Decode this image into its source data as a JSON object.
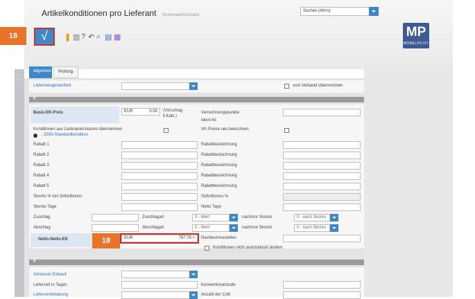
{
  "header": {
    "title": "Artikelkonditionen pro Lieferant",
    "subtitle": "Systemadministrator",
    "search_value": "Suchen (Alt+s)",
    "logo_text": "MP",
    "logo_subtext": "MÖBELPILOT"
  },
  "toolbar": {
    "save_symbol": "√",
    "icons": [
      "bookmark-icon",
      "trash-icon",
      "help-icon",
      "back-icon",
      "search-icon",
      "print-icon",
      "calendar-icon"
    ]
  },
  "badges": {
    "top": "18",
    "mid": "18"
  },
  "tabs": [
    "allgemein",
    "Prüfung"
  ],
  "form": {
    "liefermengeneinheit": "Liefermengeneinheit",
    "vom_verband": "vom Verband übernommen",
    "basis_ek_label": "Basis-EK-Preis",
    "basis_ek_currency": "EUR",
    "basis_ek_value": "0.00",
    "vorschlag": "(Vorschlag lt.Kalk.)",
    "verrechnungspunkte": "Verrechnungspunkte",
    "ident_nr": "Ident-Nr.",
    "konditionen_aus": "Konditionen aus Lieferantenstamm übernehmen",
    "emv_standard": "→EMV-Standardkondition",
    "vk_preise": "VK-Preise neu berechnen",
    "rabatt1": "Rabatt 1",
    "rabatt2": "Rabatt 2",
    "rabatt3": "Rabatt 3",
    "rabatt4": "Rabatt 4",
    "rabatt5": "Rabatt 5",
    "rabattbezeichnung": "Rabattbezeichnung",
    "skonto_sofortbonus": "Skonto % incl.Sofortbonus",
    "sofortbonus": "Sofortbonus %",
    "skonto_tage": "Skonto Tage",
    "netto_tage": "Netto Tage",
    "zuschlag": "Zuschlag",
    "zuschlagart": "Zuschlagart",
    "zuschlagart_value": "0 - Wert",
    "nach_vor_skonto": "nach/vor Skonto",
    "nach_skonto_value": "0 - nach Skonto",
    "abschlag": "Abschlag",
    "abschlagart": "Abschlagart",
    "abschlagart_value": "0 - Wert",
    "nach_vor_skonto2": "nach/vor Skonto",
    "nach_skonto_value2": "0 - nach Skonto",
    "netto_netto_label": "Netto-Netto-EK",
    "netto_currency": "EUR",
    "netto_value": "797.78 ×",
    "nachkommastellen": "Nachkommastellen",
    "konditionen_nicht_auto": "Konditionen nicht automatisch ändern",
    "vorsteuer": "Vorsteuer Einkauf",
    "lieferzeit": "Lieferzeit in Tagen",
    "konventionalstrafe": "Konventionalstrafe",
    "liefervereinbarung": "Liefervereinbarung",
    "anzahl_colli": "Anzahl der Colli"
  }
}
